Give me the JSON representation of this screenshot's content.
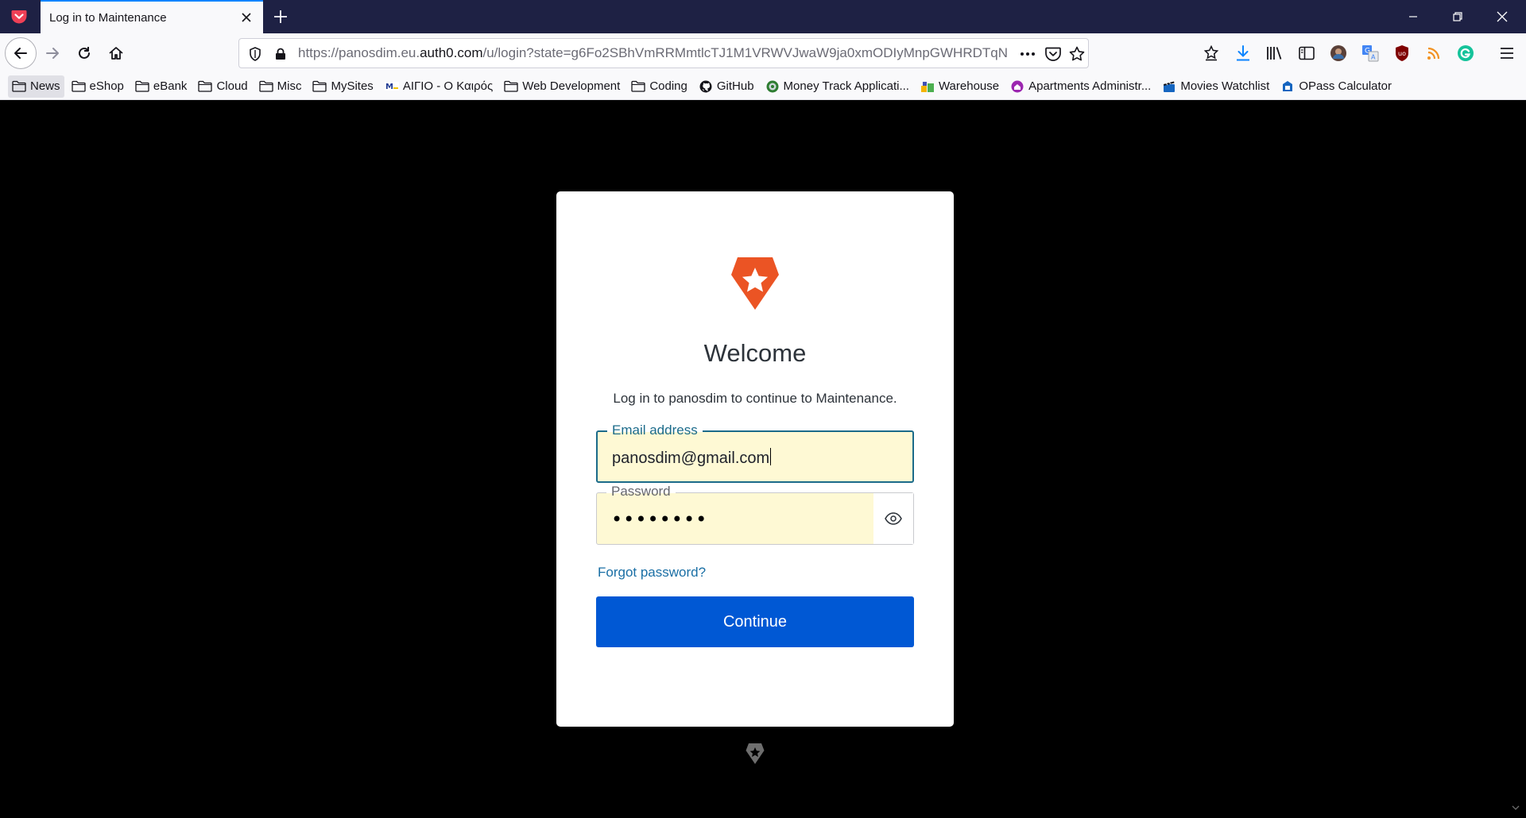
{
  "browser": {
    "tab_title": "Log in to Maintenance",
    "url_prefix": "https://panosdim.eu.",
    "url_domain": "auth0.com",
    "url_rest": "/u/login?state=g6Fo2SBhVmRRMmtlcTJ1M1VRWVJwaW9ja0xmODIyMnpGWHRDTqN",
    "icons": {
      "pocket": "pocket-icon",
      "close": "close-icon",
      "new_tab": "plus-icon",
      "minimize": "minimize-icon",
      "restore": "restore-icon",
      "window_close": "close-icon"
    }
  },
  "bookmarks": [
    {
      "label": "News",
      "icon": "folder-icon",
      "active": true
    },
    {
      "label": "eShop",
      "icon": "folder-icon"
    },
    {
      "label": "eBank",
      "icon": "folder-icon"
    },
    {
      "label": "Cloud",
      "icon": "folder-icon"
    },
    {
      "label": "Misc",
      "icon": "folder-icon"
    },
    {
      "label": "MySites",
      "icon": "folder-icon"
    },
    {
      "label": "ΑΙΓΙΟ - Ο Καιρός",
      "icon": "meteo-icon"
    },
    {
      "label": "Web Development",
      "icon": "folder-icon"
    },
    {
      "label": "Coding",
      "icon": "folder-icon"
    },
    {
      "label": "GitHub",
      "icon": "github-icon"
    },
    {
      "label": "Money Track Applicati...",
      "icon": "money-icon"
    },
    {
      "label": "Warehouse",
      "icon": "warehouse-icon"
    },
    {
      "label": "Apartments Administr...",
      "icon": "home-icon"
    },
    {
      "label": "Movies Watchlist",
      "icon": "clapper-icon"
    },
    {
      "label": "OPass Calculator",
      "icon": "calculator-icon"
    }
  ],
  "login": {
    "welcome": "Welcome",
    "subtitle": "Log in to panosdim to continue to Maintenance.",
    "email_label": "Email address",
    "email_value": "panosdim@gmail.com",
    "password_label": "Password",
    "password_mask": "••••••••",
    "forgot": "Forgot password?",
    "continue": "Continue"
  },
  "colors": {
    "brand": "#eb5424",
    "primary_button": "#0058d4",
    "link": "#1a6fa5",
    "autofill": "#fef9d4",
    "tab_bar": "#1e2144"
  }
}
